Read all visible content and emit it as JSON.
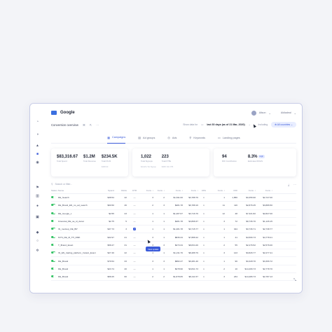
{
  "app": {
    "name": "Google",
    "user": "Alison",
    "workspace": "Aldiadeal"
  },
  "sub": {
    "title": "Conversion overview",
    "date_prefix": "Show data for",
    "date_range": "last 30 days (as of 21 Mar, 2020)",
    "including": "Including",
    "countries": "All countries"
  },
  "tabs": [
    {
      "label": "Campaigns",
      "icon": "▦"
    },
    {
      "label": "Ad groups",
      "icon": "▤"
    },
    {
      "label": "Ads",
      "icon": "◎"
    },
    {
      "label": "Keywords",
      "icon": "⚲"
    },
    {
      "label": "Landing pages",
      "icon": "▭"
    }
  ],
  "cards": {
    "c1": [
      {
        "value": "$83,316.67",
        "label": "Total Spend"
      },
      {
        "value": "$1.2M",
        "label": "Total Revenue"
      },
      {
        "value": "$234.5K",
        "label": "Total Profit",
        "extra": "$468.90"
      }
    ],
    "c2": [
      {
        "value": "1,022",
        "label": "Total Signups",
        "extra": "$4,623 / $1 Signup"
      },
      {
        "value": "223",
        "label": "Total FTBs",
        "extra": "$368 / $1 FTB"
      }
    ],
    "c3": [
      {
        "value": "94",
        "label": "ROI Contribution"
      },
      {
        "value": "8.3%",
        "label": "Estimated ROAS",
        "badge": "High"
      }
    ]
  },
  "table": {
    "search_placeholder": "Search or filter...",
    "headers": [
      "Status",
      "Name",
      "Spend",
      "Clicks",
      "CTR",
      "Conv. ↕",
      "Conv. ↕",
      "Conv. ↕",
      "Conv. ↕",
      "CPA",
      "Conv. ↕",
      "ROI",
      "Conv. ↕",
      "Conv. ↕"
    ],
    "rows": [
      [
        "",
        "DE_Search",
        "$38.54",
        "42",
        "—",
        "3",
        "2",
        "$1,811.00",
        "$3,788.76",
        "⋏",
        "1",
        "1,856",
        "$3,356.90",
        "$2,727.00"
      ],
      [
        "",
        "DE_Brand_EN_no_ad_search",
        "$60.50",
        "46",
        "—",
        "2",
        "3",
        "$281.78",
        "$6,788.16",
        "⋏",
        "11",
        "116",
        "$2,876.45",
        "$3,886.50"
      ],
      [
        "",
        "DE_Google_x",
        "$2.55",
        "23",
        "—",
        "1",
        "1",
        "$1,287.67",
        "$3,716.76",
        "⋏",
        "12",
        "48",
        "$7,321.82",
        "$2,827.00"
      ],
      [
        "",
        "Financial_DE_sa_id_donut",
        "$2.75",
        "5",
        "—",
        "1",
        "1",
        "$281.78",
        "$3,868.37",
        "⋏",
        "3",
        "72",
        "$9,736.70",
        "$1,126.15"
      ],
      [
        "",
        "IN_mockup_DE_BP",
        "$37.73",
        "3",
        "↗",
        "1",
        "1",
        "$1,281.78",
        "$3,715.77",
        "⋏",
        "1",
        "344",
        "$3,736.71",
        "$2,738.77"
      ],
      [
        "",
        "MYS_DE_M_TH_DMK",
        "$32.97",
        "21",
        "—",
        "3",
        "1",
        "$836.34",
        "$7,888.42",
        "⋏",
        "1",
        "41",
        "$4,566.73",
        "$4,778.21"
      ],
      [
        "",
        "T_Brand_Exact",
        "$58.47",
        "31",
        "—",
        "3",
        "3",
        "$273.34",
        "$8,834.46",
        "⋏",
        "2",
        "55",
        "$2,476.52",
        "$2,576.00"
      ],
      [
        "",
        "IN_EN_trading_platform_Instant_Exact",
        "$27.46",
        "22",
        "—",
        "1",
        "1",
        "$1,211.76",
        "$8,488.79",
        "⋏",
        "3",
        "143",
        "$3,826.77",
        "$2,277.41"
      ],
      [
        "",
        "DE_Brand",
        "$79.54",
        "33",
        "—",
        "3",
        "3",
        "$882.47",
        "$6,281.40",
        "⋏",
        "1",
        "96",
        "$3,328.70",
        "$3,366.72"
      ],
      [
        "",
        "DE_Brand",
        "$23.74",
        "20",
        "—",
        "1",
        "1",
        "$278.96",
        "$3,841.73",
        "⋏",
        "2",
        "10",
        "$14,466.73",
        "$2,778.70"
      ],
      [
        "",
        "DE_Brand",
        "$58.25",
        "60",
        "—",
        "2",
        "2",
        "$1,878.65",
        "$8,411.57",
        "⋏",
        "3",
        "234",
        "$14,486.73",
        "$2,787.13"
      ]
    ],
    "tooltip": "View update"
  },
  "colors": {
    "accent": "#3a5ad9",
    "toggle_on": "#3ac46a"
  }
}
